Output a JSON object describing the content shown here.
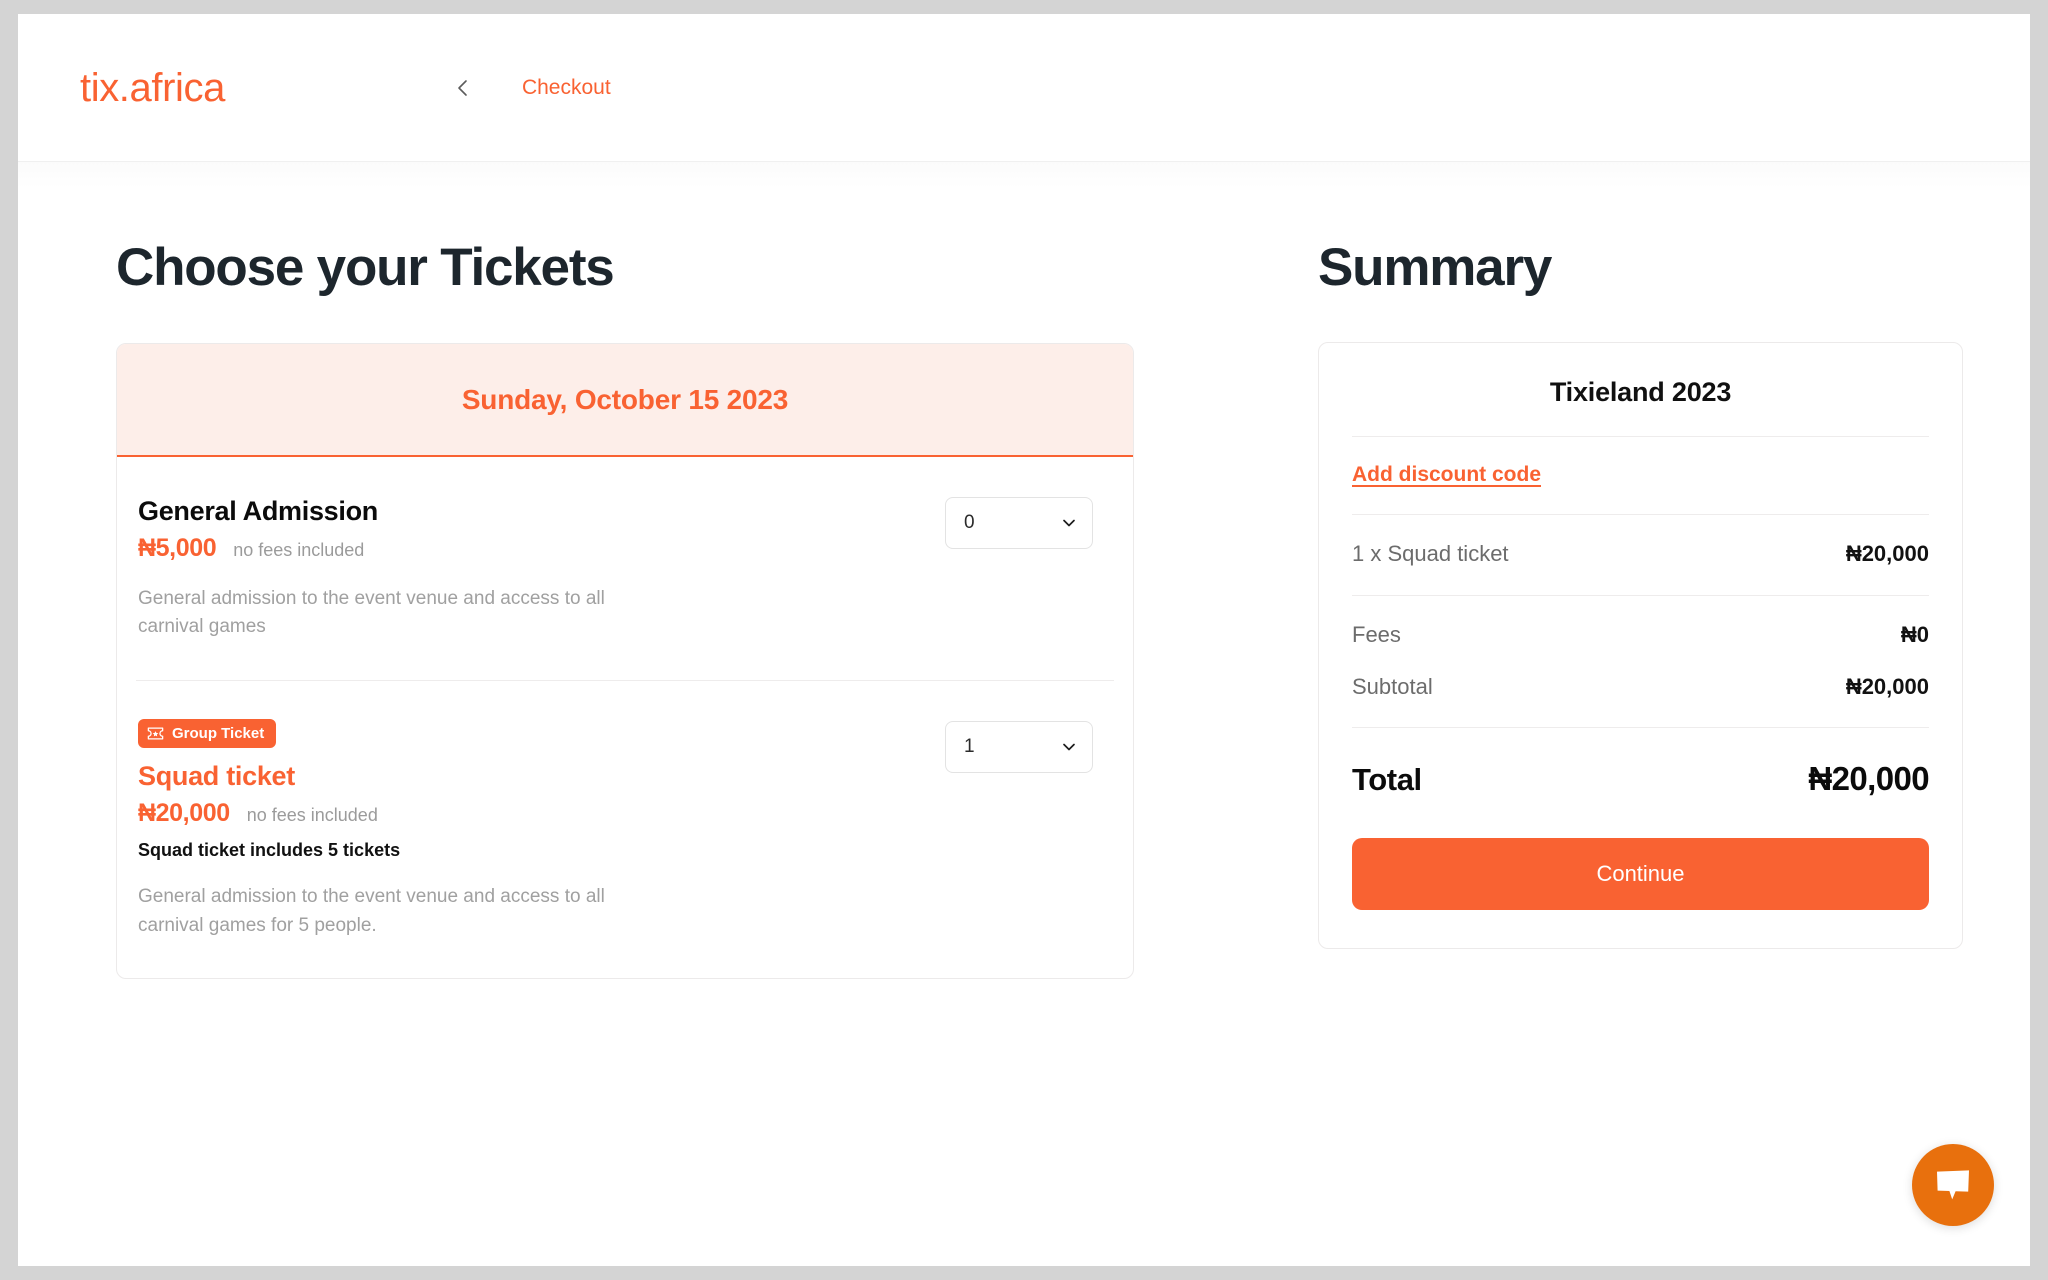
{
  "header": {
    "brand": "tix.africa",
    "back_icon": "chevron-left-icon",
    "breadcrumb": "Checkout"
  },
  "main": {
    "title": "Choose your Tickets",
    "date_banner": "Sunday, October 15 2023",
    "tickets": [
      {
        "name": "General Admission",
        "price": "₦5,000",
        "fees_note": "no fees included",
        "description": "General admission to the event venue and access to all carnival games",
        "quantity": "0",
        "badge": null,
        "includes_note": null
      },
      {
        "name": "Squad ticket",
        "price": "₦20,000",
        "fees_note": "no fees included",
        "description": "General admission to the event venue and access to all carnival games for 5 people.",
        "quantity": "1",
        "badge": "Group Ticket",
        "includes_note": "Squad ticket includes 5 tickets"
      }
    ]
  },
  "summary": {
    "title": "Summary",
    "event_name": "Tixieland 2023",
    "discount_link": "Add discount code",
    "items": [
      {
        "label": "1 x Squad ticket",
        "value": "₦20,000"
      }
    ],
    "totals": [
      {
        "label": "Fees",
        "value": "₦0"
      },
      {
        "label": "Subtotal",
        "value": "₦20,000"
      }
    ],
    "total_label": "Total",
    "total_value": "₦20,000",
    "continue_label": "Continue"
  },
  "chat": {
    "icon": "chat-bubble-icon"
  },
  "colors": {
    "accent": "#f96232",
    "accent_soft": "#fdeee9",
    "text_dark": "#1d262d",
    "text_muted": "#a0a0a0",
    "chat_orange": "#e8700d",
    "page_backdrop": "#d4d4d4"
  }
}
